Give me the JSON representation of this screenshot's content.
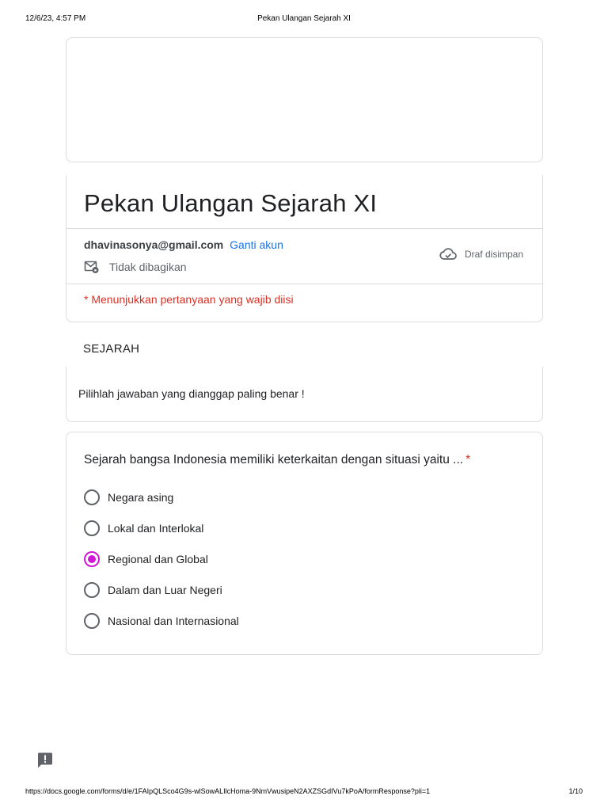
{
  "print_header": {
    "datetime": "12/6/23, 4:57 PM",
    "doc_title": "Pekan Ulangan Sejarah XI"
  },
  "form": {
    "title": "Pekan Ulangan Sejarah XI",
    "account_email": "dhavinasonya@gmail.com",
    "switch_account": "Ganti akun",
    "share_status": "Tidak dibagikan",
    "draft_status": "Draf disimpan",
    "required_note": "* Menunjukkan pertanyaan yang wajib diisi"
  },
  "section": {
    "title": "SEJARAH",
    "description": "Pilihlah jawaban yang dianggap paling benar !"
  },
  "question": {
    "text": "Sejarah bangsa Indonesia memiliki keterkaitan dengan situasi yaitu ...",
    "required_mark": "*",
    "selected_color": "#d016d6",
    "options": [
      {
        "label": "Negara asing",
        "selected": false
      },
      {
        "label": "Lokal dan Interlokal",
        "selected": false
      },
      {
        "label": "Regional dan Global",
        "selected": true
      },
      {
        "label": "Dalam dan Luar Negeri",
        "selected": false
      },
      {
        "label": "Nasional dan Internasional",
        "selected": false
      }
    ]
  },
  "icons": {
    "share": "mail-lock-icon",
    "draft": "cloud-check-icon",
    "report": "feedback-icon"
  },
  "print_footer": {
    "url": "https://docs.google.com/forms/d/e/1FAIpQLSco4G9s-wlSowALIlcHoma-9NmVwusipeN2AXZSGdIVu7kPoA/formResponse?pli=1",
    "page": "1/10"
  }
}
